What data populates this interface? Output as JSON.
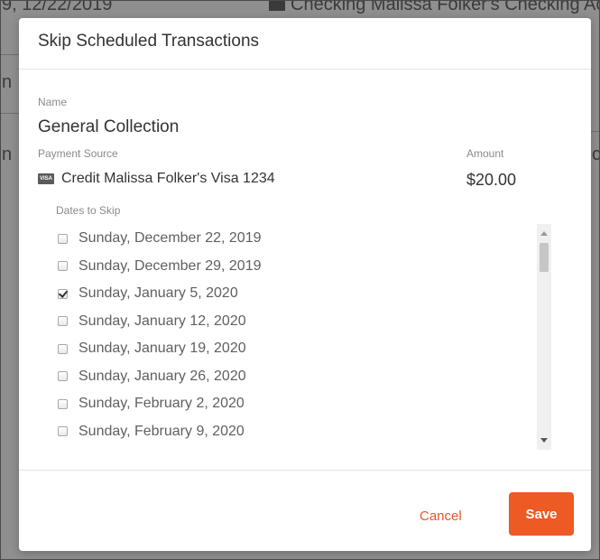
{
  "background": {
    "top_left_text": "9, 12/22/2019",
    "top_right_text": "Checking Malissa Folker's Checking Acco",
    "side_letter_1": "n",
    "side_letter_2": "n",
    "side_letter_right": "c"
  },
  "modal": {
    "title": "Skip Scheduled Transactions",
    "name_label": "Name",
    "name_value": "General Collection",
    "payment_source_label": "Payment Source",
    "payment_source_icon": "visa-card-icon",
    "payment_source_value": "Credit Malissa Folker's Visa 1234",
    "amount_label": "Amount",
    "amount_value": "$20.00",
    "dates_label": "Dates to Skip",
    "dates": [
      {
        "label": "Sunday, December 22, 2019",
        "checked": false
      },
      {
        "label": "Sunday, December 29, 2019",
        "checked": false
      },
      {
        "label": "Sunday, January 5, 2020",
        "checked": true
      },
      {
        "label": "Sunday, January 12, 2020",
        "checked": false
      },
      {
        "label": "Sunday, January 19, 2020",
        "checked": false
      },
      {
        "label": "Sunday, January 26, 2020",
        "checked": false
      },
      {
        "label": "Sunday, February 2, 2020",
        "checked": false
      },
      {
        "label": "Sunday, February 9, 2020",
        "checked": false
      }
    ],
    "cancel_label": "Cancel",
    "save_label": "Save"
  },
  "colors": {
    "accent": "#ee5a24",
    "overlay": "#8f8f8f"
  }
}
